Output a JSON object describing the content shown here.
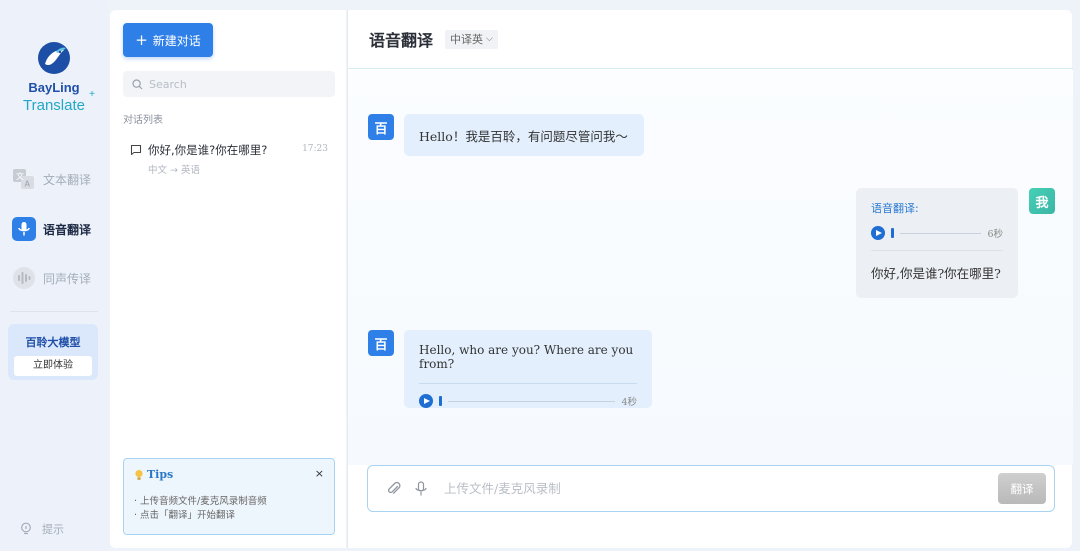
{
  "brand": {
    "name_line1": "BayLing",
    "name_line2": "Translate",
    "spark": "+"
  },
  "nav": {
    "items": [
      {
        "label": "文本翻译",
        "icon": "text-translate-icon",
        "active": false
      },
      {
        "label": "语音翻译",
        "icon": "microphone-icon",
        "active": true
      },
      {
        "label": "同声传译",
        "icon": "simultaneous-interpret-icon",
        "active": false
      }
    ],
    "promo": {
      "title": "百聆大模型",
      "button": "立即体验"
    },
    "hint": "提示"
  },
  "sidebar": {
    "new_chat": "新建对话",
    "search_placeholder": "Search",
    "list_title": "对话列表",
    "conversations": [
      {
        "title": "你好,你是谁?你在哪里?",
        "time": "17:23",
        "subtitle": "中文 → 英语"
      }
    ],
    "tips": {
      "title": "Tips",
      "close": "×",
      "lines": [
        "· 上传音频文件/麦克风录制音频",
        "· 点击「翻译」开始翻译"
      ]
    }
  },
  "main": {
    "title": "语音翻译",
    "lang_mode": "中译英",
    "messages": [
      {
        "role": "bot",
        "avatar": "百",
        "text": "Hello！我是百聆，有问题尽管问我～"
      },
      {
        "role": "me",
        "avatar": "我",
        "label": "语音翻译:",
        "audio_duration": "6秒",
        "text": "你好,你是谁?你在哪里?"
      },
      {
        "role": "bot",
        "avatar": "百",
        "text": "Hello, who are you? Where are you from?",
        "audio_duration": "4秒"
      }
    ],
    "input": {
      "placeholder": "上传文件/麦克风录制",
      "send": "翻译"
    }
  },
  "colors": {
    "accent": "#2e7fe8",
    "brand_dark": "#1f4fa8",
    "brand_teal": "#22a7c7",
    "me_avatar": "#3bb6a6"
  }
}
